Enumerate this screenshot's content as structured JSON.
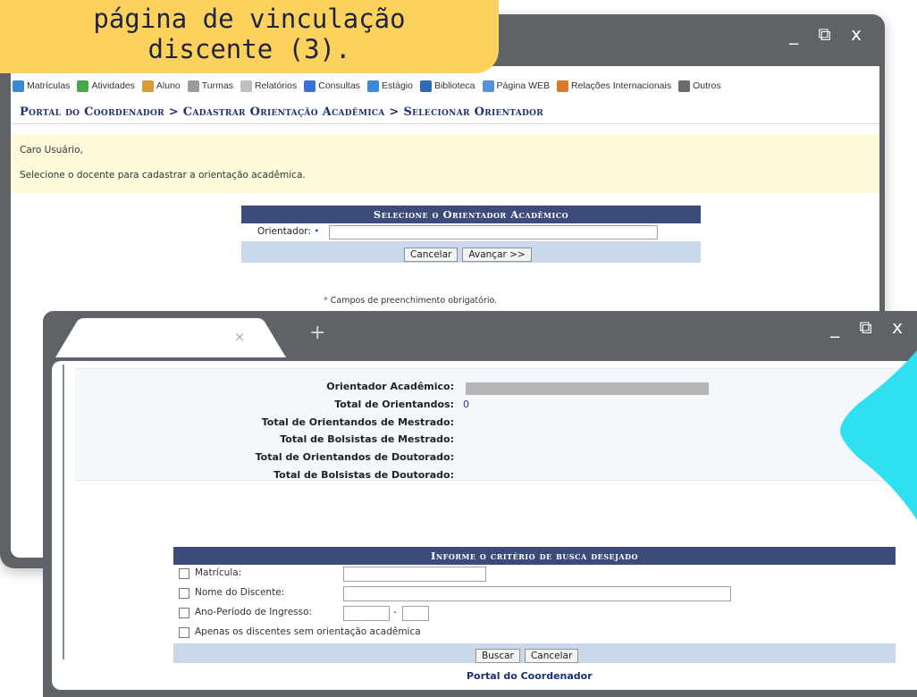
{
  "banner": {
    "line1": "página de vinculação",
    "line2": "discente (3)."
  },
  "back_window": {
    "controls": "_ ⧉ x",
    "menu": [
      {
        "label": "Matrículas",
        "icon": "enrollment-icon",
        "color": "#3b8ad9"
      },
      {
        "label": "Atividades",
        "icon": "activities-icon",
        "color": "#4aa84a"
      },
      {
        "label": "Aluno",
        "icon": "student-icon",
        "color": "#d99a3b"
      },
      {
        "label": "Turmas",
        "icon": "classes-icon",
        "color": "#9a9a9a"
      },
      {
        "label": "Relatórios",
        "icon": "reports-icon",
        "color": "#bfbfbf"
      },
      {
        "label": "Consultas",
        "icon": "search-icon",
        "color": "#3b6fd9"
      },
      {
        "label": "Estágio",
        "icon": "internship-icon",
        "color": "#3b8ad9"
      },
      {
        "label": "Biblioteca",
        "icon": "library-icon",
        "color": "#2d6bb8"
      },
      {
        "label": "Página WEB",
        "icon": "web-page-icon",
        "color": "#5a8fd9"
      },
      {
        "label": "Relações Internacionais",
        "icon": "international-icon",
        "color": "#d97a2b"
      },
      {
        "label": "Outros",
        "icon": "phone-icon",
        "color": "#6b6b6b"
      }
    ],
    "breadcrumb": "Portal do Coordenador > Cadastrar Orientação Acadêmica > Selecionar Orientador",
    "notice": {
      "greeting": "Caro Usuário,",
      "message": "Selecione o docente para cadastrar a orientação acadêmica."
    },
    "form": {
      "title": "Selecione o Orientador Acadêmico",
      "field_label": "Orientador:",
      "required_mark": "•",
      "field_value": "",
      "cancel": "Cancelar",
      "next": "Avançar >>"
    },
    "required_note_mark": "*",
    "required_note": "Campos de preenchimento obrigatório."
  },
  "front_window": {
    "tab_close": "×",
    "new_tab": "+",
    "controls": "_ ⧉ x",
    "summary": [
      {
        "label": "Orientador Acadêmico:",
        "value": ""
      },
      {
        "label": "Total de Orientandos:",
        "value": "0"
      },
      {
        "label": "Total de Orientandos de Mestrado:",
        "value": ""
      },
      {
        "label": "Total de Bolsistas de Mestrado:",
        "value": ""
      },
      {
        "label": "Total de Orientandos de Doutorado:",
        "value": ""
      },
      {
        "label": "Total de Bolsistas de Doutorado:",
        "value": ""
      }
    ],
    "search_form": {
      "title": "Informe o critério de busca desejado",
      "matricula": "Matrícula:",
      "nome": "Nome do Discente:",
      "ano_periodo": "Ano-Período de Ingresso:",
      "ano_sep": "-",
      "sem_orientacao": "Apenas os discentes sem orientação acadêmica",
      "search": "Buscar",
      "cancel": "Cancelar"
    },
    "footer_link": "Portal do Coordenador"
  },
  "colors": {
    "accent_yellow": "#fcd25c",
    "window_gray": "#5f6368",
    "form_header": "#3c4b79",
    "form_footer": "#cad8ec",
    "breadcrumb": "#1d2f73",
    "cyan_shape": "#2ee0f0"
  }
}
